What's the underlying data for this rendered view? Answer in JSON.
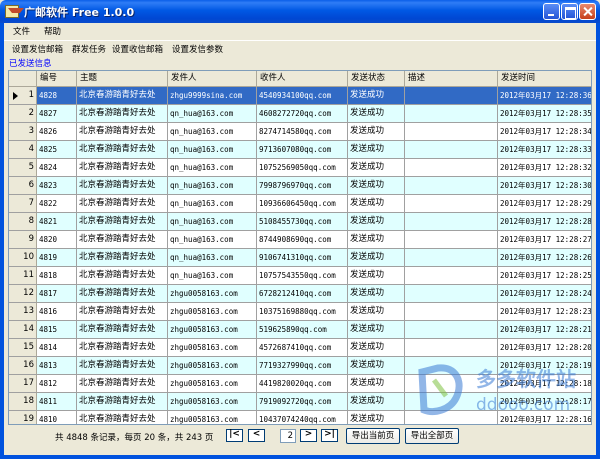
{
  "window": {
    "title": "广邮软件 Free 1.0.0"
  },
  "menu": [
    "文件",
    "帮助"
  ],
  "toolbar": [
    "设置发信邮箱",
    "群发任务",
    "设置收信邮箱",
    "设置发信参数"
  ],
  "section_label": "已发送信息",
  "table": {
    "columns": [
      "编号",
      "主题",
      "发件人",
      "收件人",
      "发送状态",
      "描述",
      "发送时间"
    ],
    "rows": [
      [
        "4828",
        "北京春游踏青好去处",
        "zhgu9999sina.com",
        "4540934100qq.com",
        "发送成功",
        "",
        "2012年03月17 12:28:36"
      ],
      [
        "4827",
        "北京春游踏青好去处",
        "qn_hua@163.com",
        "4608272720qq.com",
        "发送成功",
        "",
        "2012年03月17 12:28:35"
      ],
      [
        "4826",
        "北京春游踏青好去处",
        "qn_hua@163.com",
        "8274714580qq.com",
        "发送成功",
        "",
        "2012年03月17 12:28:34"
      ],
      [
        "4825",
        "北京春游踏青好去处",
        "qn_hua@163.com",
        "9713607080qq.com",
        "发送成功",
        "",
        "2012年03月17 12:28:33"
      ],
      [
        "4824",
        "北京春游踏青好去处",
        "qn_hua@163.com",
        "10752569050qq.com",
        "发送成功",
        "",
        "2012年03月17 12:28:32"
      ],
      [
        "4823",
        "北京春游踏青好去处",
        "qn_hua@163.com",
        "7998796970qq.com",
        "发送成功",
        "",
        "2012年03月17 12:28:30"
      ],
      [
        "4822",
        "北京春游踏青好去处",
        "qn_hua@163.com",
        "10936606450qq.com",
        "发送成功",
        "",
        "2012年03月17 12:28:29"
      ],
      [
        "4821",
        "北京春游踏青好去处",
        "qn_hua@163.com",
        "5108455730qq.com",
        "发送成功",
        "",
        "2012年03月17 12:28:28"
      ],
      [
        "4820",
        "北京春游踏青好去处",
        "qn_hua@163.com",
        "8744908690qq.com",
        "发送成功",
        "",
        "2012年03月17 12:28:27"
      ],
      [
        "4819",
        "北京春游踏青好去处",
        "qn_hua@163.com",
        "9106741310qq.com",
        "发送成功",
        "",
        "2012年03月17 12:28:26"
      ],
      [
        "4818",
        "北京春游踏青好去处",
        "qn_hua@163.com",
        "10757543550qq.com",
        "发送成功",
        "",
        "2012年03月17 12:28:25"
      ],
      [
        "4817",
        "北京春游踏青好去处",
        "zhgu0058163.com",
        "6728212410qq.com",
        "发送成功",
        "",
        "2012年03月17 12:28:24"
      ],
      [
        "4816",
        "北京春游踏青好去处",
        "zhgu0058163.com",
        "10375169880qq.com",
        "发送成功",
        "",
        "2012年03月17 12:28:23"
      ],
      [
        "4815",
        "北京春游踏青好去处",
        "zhgu0058163.com",
        "519625890qq.com",
        "发送成功",
        "",
        "2012年03月17 12:28:21"
      ],
      [
        "4814",
        "北京春游踏青好去处",
        "zhgu0058163.com",
        "4572687410qq.com",
        "发送成功",
        "",
        "2012年03月17 12:28:20"
      ],
      [
        "4813",
        "北京春游踏青好去处",
        "zhgu0058163.com",
        "7719327990qq.com",
        "发送成功",
        "",
        "2012年03月17 12:28:19"
      ],
      [
        "4812",
        "北京春游踏青好去处",
        "zhgu0058163.com",
        "4419820020qq.com",
        "发送成功",
        "",
        "2012年03月17 12:28:18"
      ],
      [
        "4811",
        "北京春游踏青好去处",
        "zhgu0058163.com",
        "7919092720qq.com",
        "发送成功",
        "",
        "2012年03月17 12:28:17"
      ],
      [
        "4810",
        "北京春游踏青好去处",
        "zhgu0058163.com",
        "10437074240qq.com",
        "发送成功",
        "",
        "2012年03月17 12:28:16"
      ],
      [
        "4809",
        "北京春游踏青好去处",
        "zhgu0058163.com",
        "9208629180qq.com",
        "发送成功",
        "",
        "2012年03月17 12:28:15"
      ]
    ],
    "selected_row": 1
  },
  "pager": {
    "summary": "共 4848 条记录，每页 20 条，共 243 页",
    "current_page": "2",
    "first": "|<",
    "prev": "<",
    "next": ">",
    "last": ">|",
    "export_current": "导出当前页",
    "export_all": "导出全部页"
  },
  "watermark": {
    "text1": "多多软件站",
    "text2": "ddooo.com",
    "color": "#3A7BD5"
  },
  "colors": {
    "selected_row": "#316AC5",
    "alt_row": "#E0FFFF",
    "title_bar": "#0054E3"
  }
}
